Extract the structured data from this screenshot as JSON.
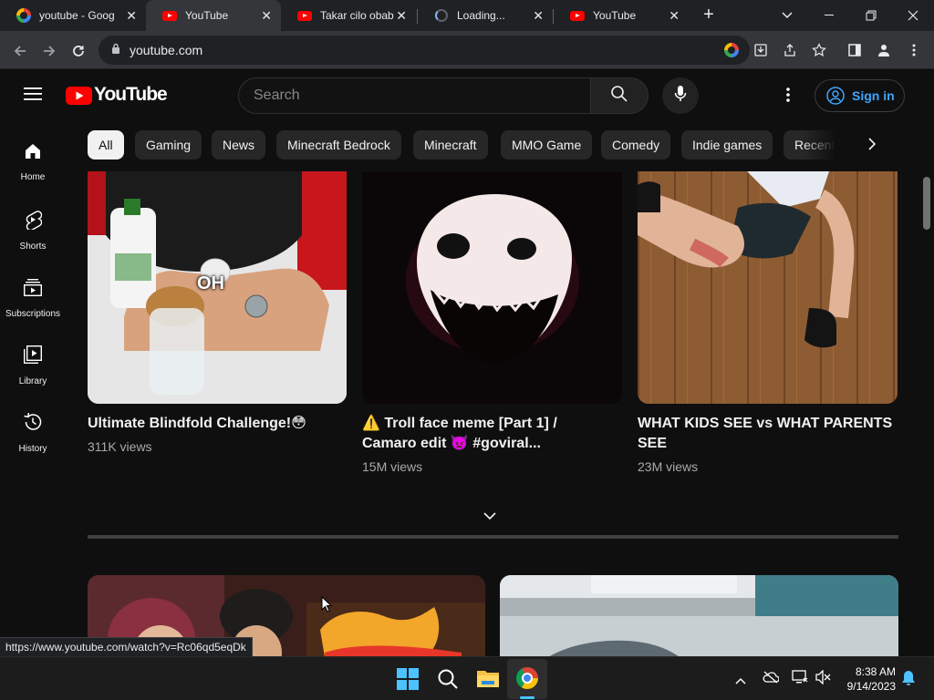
{
  "browser": {
    "tabs": [
      {
        "title": "youtube - Goog",
        "favicon": "google-icon",
        "active": false
      },
      {
        "title": "YouTube",
        "favicon": "youtube-icon",
        "active": true
      },
      {
        "title": "Takar cilo obab",
        "favicon": "youtube-icon",
        "active": false
      },
      {
        "title": "Loading...",
        "favicon": "loading-icon",
        "active": false
      },
      {
        "title": "YouTube",
        "favicon": "youtube-icon",
        "active": false
      }
    ],
    "url": "youtube.com",
    "status_url": "https://www.youtube.com/watch?v=Rc06qd5eqDk"
  },
  "header": {
    "logo": "YouTube",
    "search_placeholder": "Search",
    "signin_label": "Sign in"
  },
  "chips": [
    "All",
    "Gaming",
    "News",
    "Minecraft Bedrock",
    "Minecraft",
    "MMO Game",
    "Comedy",
    "Indie games",
    "Recent"
  ],
  "sidebar": [
    {
      "label": "Home",
      "icon": "home-icon"
    },
    {
      "label": "Shorts",
      "icon": "shorts-icon"
    },
    {
      "label": "Subscriptions",
      "icon": "subscriptions-icon"
    },
    {
      "label": "Library",
      "icon": "library-icon"
    },
    {
      "label": "History",
      "icon": "history-icon"
    }
  ],
  "videos": [
    {
      "title_line1": "Ultimate Blindfold Challenge!😳",
      "title_line2": "",
      "views": "311K views",
      "thumb_text": "OH"
    },
    {
      "title_line1": "⚠️ Troll face meme [Part 1] /",
      "title_line2": "Camaro edit 👿 #goviral...",
      "views": "15M views"
    },
    {
      "title_line1": "WHAT KIDS SEE vs WHAT PARENTS",
      "title_line2": "SEE",
      "views": "23M views"
    }
  ],
  "taskbar": {
    "time": "8:38 AM",
    "date": "9/14/2023"
  },
  "colors": {
    "background": "#0f0f0f",
    "accent_blue": "#3ea6ff",
    "youtube_red": "#ff0000"
  }
}
